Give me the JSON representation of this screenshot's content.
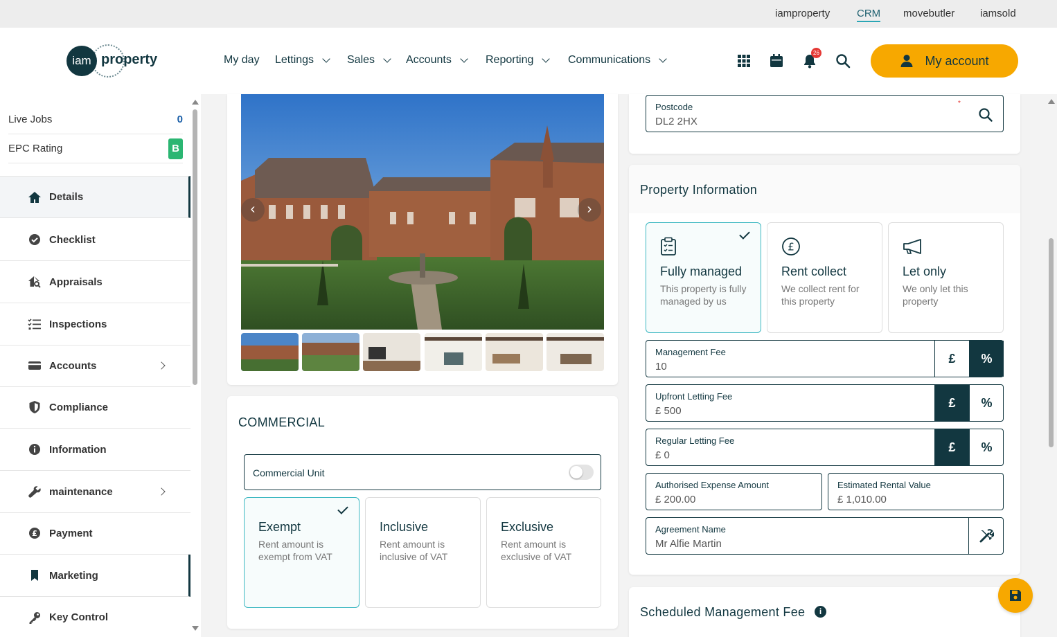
{
  "topbar": {
    "links": [
      "iamproperty",
      "CRM",
      "movebutler",
      "iamsold"
    ],
    "active": "CRM"
  },
  "logo": {
    "mark": "iam",
    "word": "property"
  },
  "nav": {
    "items": [
      "My day",
      "Lettings",
      "Sales",
      "Accounts",
      "Reporting",
      "Communications"
    ]
  },
  "header": {
    "notification_count": "26",
    "my_account_label": "My account"
  },
  "sidebar": {
    "stats": [
      {
        "label": "Live Jobs",
        "value": "0"
      },
      {
        "label": "EPC Rating",
        "value": "B"
      }
    ],
    "items": [
      "Details",
      "Checklist",
      "Appraisals",
      "Inspections",
      "Accounts",
      "Compliance",
      "Information",
      "maintenance",
      "Payment",
      "Marketing",
      "Key Control"
    ],
    "active": "Details"
  },
  "commercial": {
    "title": "COMMERCIAL",
    "unit_label": "Commercial Unit",
    "unit_enabled": false,
    "options": [
      {
        "title": "Exempt",
        "desc": "Rent amount is exempt from VAT",
        "selected": true
      },
      {
        "title": "Inclusive",
        "desc": "Rent amount is inclusive of VAT",
        "selected": false
      },
      {
        "title": "Exclusive",
        "desc": "Rent amount is exclusive of VAT",
        "selected": false
      }
    ]
  },
  "postcode": {
    "label": "Postcode",
    "value": "DL2 2HX"
  },
  "property_info": {
    "title": "Property Information",
    "services": [
      {
        "title": "Fully managed",
        "desc": "This property is fully managed by us",
        "icon": "clipboard-icon",
        "selected": true
      },
      {
        "title": "Rent collect",
        "desc": "We collect rent for this property",
        "icon": "pound-coin-icon",
        "selected": false
      },
      {
        "title": "Let only",
        "desc": "We only let this property",
        "icon": "megaphone-icon",
        "selected": false
      }
    ],
    "currency_symbol": "£",
    "percent_symbol": "%",
    "management_fee": {
      "label": "Management Fee",
      "value": "10",
      "unit": "percent"
    },
    "upfront_fee": {
      "label": "Upfront Letting Fee",
      "value": "£ 500",
      "unit": "pound"
    },
    "regular_fee": {
      "label": "Regular Letting Fee",
      "value": "£ 0",
      "unit": "pound"
    },
    "authorised_expense": {
      "label": "Authorised Expense Amount",
      "value": "£ 200.00"
    },
    "estimated_rental": {
      "label": "Estimated Rental Value",
      "value": "£ 1,010.00"
    },
    "agreement_name": {
      "label": "Agreement Name",
      "value": "Mr Alfie Martin"
    }
  },
  "scheduled": {
    "title": "Scheduled Management Fee",
    "info": "i"
  },
  "colors": {
    "brand_dark": "#123740",
    "accent": "#f7a800",
    "teal": "#3ab7c1",
    "epc_green": "#2bb672"
  }
}
